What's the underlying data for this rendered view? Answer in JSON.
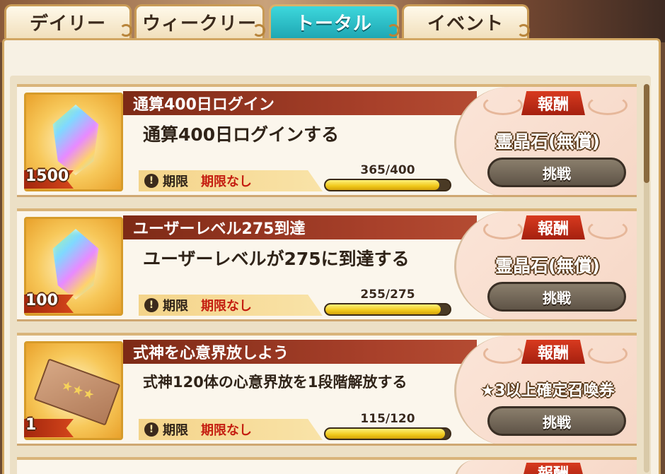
{
  "tabs": [
    {
      "label": "デイリー",
      "active": false
    },
    {
      "label": "ウィークリー",
      "active": false
    },
    {
      "label": "トータル",
      "active": true
    },
    {
      "label": "イベント",
      "active": false
    }
  ],
  "missions": [
    {
      "title": "通算400日ログイン",
      "description": "通算400日ログインする",
      "item_icon": "spirit-crystal-icon",
      "item_quantity": "1500",
      "deadline_label": "期限",
      "deadline_value": "期限なし",
      "progress_text": "365/400",
      "progress_fraction": 0.9125,
      "reward_badge": "報酬",
      "reward_name": "霊晶石(無償)",
      "button_label": "挑戦"
    },
    {
      "title": "ユーザーレベル275到達",
      "description": "ユーザーレベルが275に到達する",
      "item_icon": "spirit-crystal-icon",
      "item_quantity": "100",
      "deadline_label": "期限",
      "deadline_value": "期限なし",
      "progress_text": "255/275",
      "progress_fraction": 0.927,
      "reward_badge": "報酬",
      "reward_name": "霊晶石(無償)",
      "button_label": "挑戦"
    },
    {
      "title": "式神を心意界放しよう",
      "description": "式神120体の心意界放を1段階解放する",
      "item_icon": "summon-ticket-icon",
      "item_quantity": "1",
      "deadline_label": "期限",
      "deadline_value": "期限なし",
      "progress_text": "115/120",
      "progress_fraction": 0.958,
      "reward_badge": "報酬",
      "reward_name": "★3以上確定召喚券",
      "button_label": "挑戦"
    }
  ],
  "partial_next": {
    "reward_badge": "報酬"
  },
  "colors": {
    "active_tab": "#2fbfc7",
    "title_bar": "#8e311c",
    "deadline_text": "#c41d10",
    "progress_fill": "#f0c81a"
  }
}
